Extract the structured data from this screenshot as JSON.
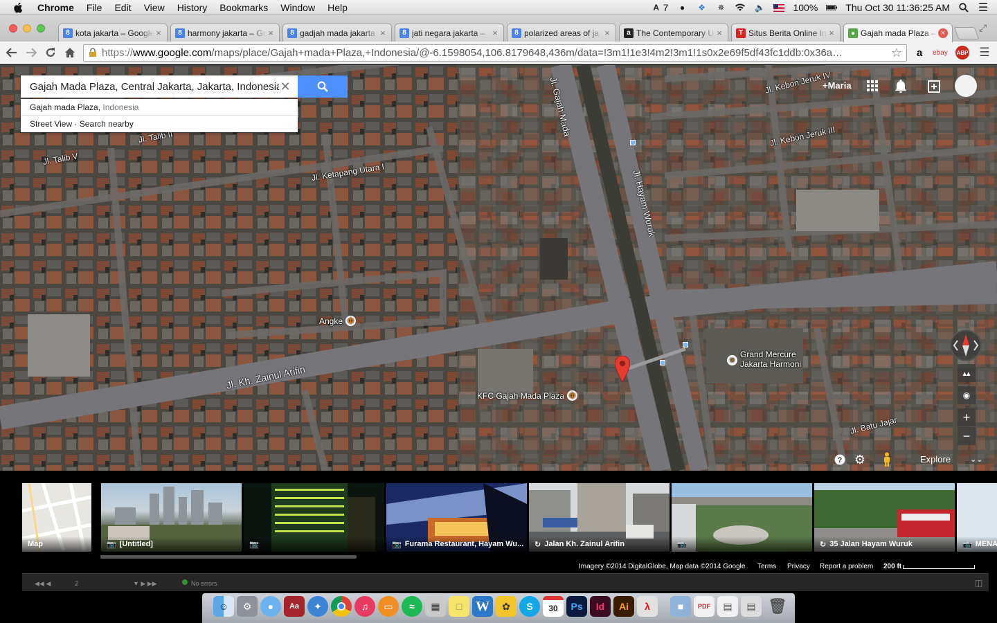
{
  "menubar": {
    "app_name": "Chrome",
    "items": [
      "File",
      "Edit",
      "View",
      "History",
      "Bookmarks",
      "Window",
      "Help"
    ],
    "adobe_count": "7",
    "battery": "100%",
    "datetime": "Thu Oct 30  11:36:25 AM"
  },
  "tabs": [
    {
      "label": "kota jakarta – Google",
      "favicon": "google-g-icon",
      "color": "#4a82ee"
    },
    {
      "label": "harmony jakarta – Go",
      "favicon": "google-g-icon",
      "color": "#4a82ee"
    },
    {
      "label": "gadjah mada jakarta",
      "favicon": "google-g-icon",
      "color": "#4a82ee"
    },
    {
      "label": "jati negara jakarta –",
      "favicon": "google-g-icon",
      "color": "#4a82ee"
    },
    {
      "label": "polarized areas of ja",
      "favicon": "google-g-icon",
      "color": "#4a82ee"
    },
    {
      "label": "The Contemporary U",
      "favicon": "amazon-a-icon",
      "color": "#222222"
    },
    {
      "label": "Situs Berita Online In",
      "favicon": "tempo-t-icon",
      "color": "#d6261e"
    },
    {
      "label": "Gajah mada Plaza –",
      "favicon": "google-maps-icon",
      "color": "#55a747",
      "active": true
    }
  ],
  "toolbar": {
    "url_scheme": "https://",
    "url_host": "www.google.com",
    "url_path": "/maps/place/Gajah+mada+Plaza,+Indonesia/@-6.1598054,106.8179648,436m/data=!3m1!1e3!4m2!3m1!1s0x2e69f5df43fc1ddb:0x36a…"
  },
  "maps": {
    "search_value": "Gajah Mada Plaza, Central Jakarta, Jakarta, Indonesia",
    "suggestions": [
      {
        "main": "Gajah mada Plaza, ",
        "secondary": "Indonesia"
      },
      {
        "main": "Street View · Search nearby",
        "secondary": ""
      }
    ],
    "account_label": "+Maria",
    "roads": [
      "Jl. Gajah Mada",
      "Jl. Hayam Wuruk",
      "Jl. Kebon Jeruk IV",
      "Jl. Kebon Jeruk III",
      "Jl. Talib II",
      "Jl. Talib V",
      "Jl. Ketapang Utara I",
      "Jl. Kh. Zainul Arifin",
      "Jl. Batu Jajar"
    ],
    "pois": {
      "angke": "Angke",
      "kfc": "KFC Gajah Mada Plaza",
      "grand_mercure_1": "Grand Mercure",
      "grand_mercure_2": "Jakarta Harmoni"
    },
    "explore_label": "Explore"
  },
  "photos": [
    {
      "caption": "Map",
      "kind": "map"
    },
    {
      "caption": "[Untitled]",
      "kind": "camera-icon"
    },
    {
      "caption": "",
      "kind": "camera-icon"
    },
    {
      "caption": "Furama Restaurant, Hayam Wu...",
      "kind": "camera-icon"
    },
    {
      "caption": "Jalan Kh. Zainul Arifin",
      "kind": "streetview-icon"
    },
    {
      "caption": "",
      "kind": "camera-icon"
    },
    {
      "caption": "35 Jalan Hayam Wuruk",
      "kind": "streetview-icon"
    },
    {
      "caption": "MENA",
      "kind": "camera-icon"
    }
  ],
  "attribution": {
    "imagery": "Imagery ©2014 DigitalGlobe, Map data ©2014 Google",
    "terms": "Terms",
    "privacy": "Privacy",
    "report": "Report a problem",
    "scale": "200 ft"
  },
  "console": {
    "status": "No errors",
    "page": "2"
  },
  "colors": {
    "search_button": "#4d90fe",
    "pin": "#e53b30"
  }
}
